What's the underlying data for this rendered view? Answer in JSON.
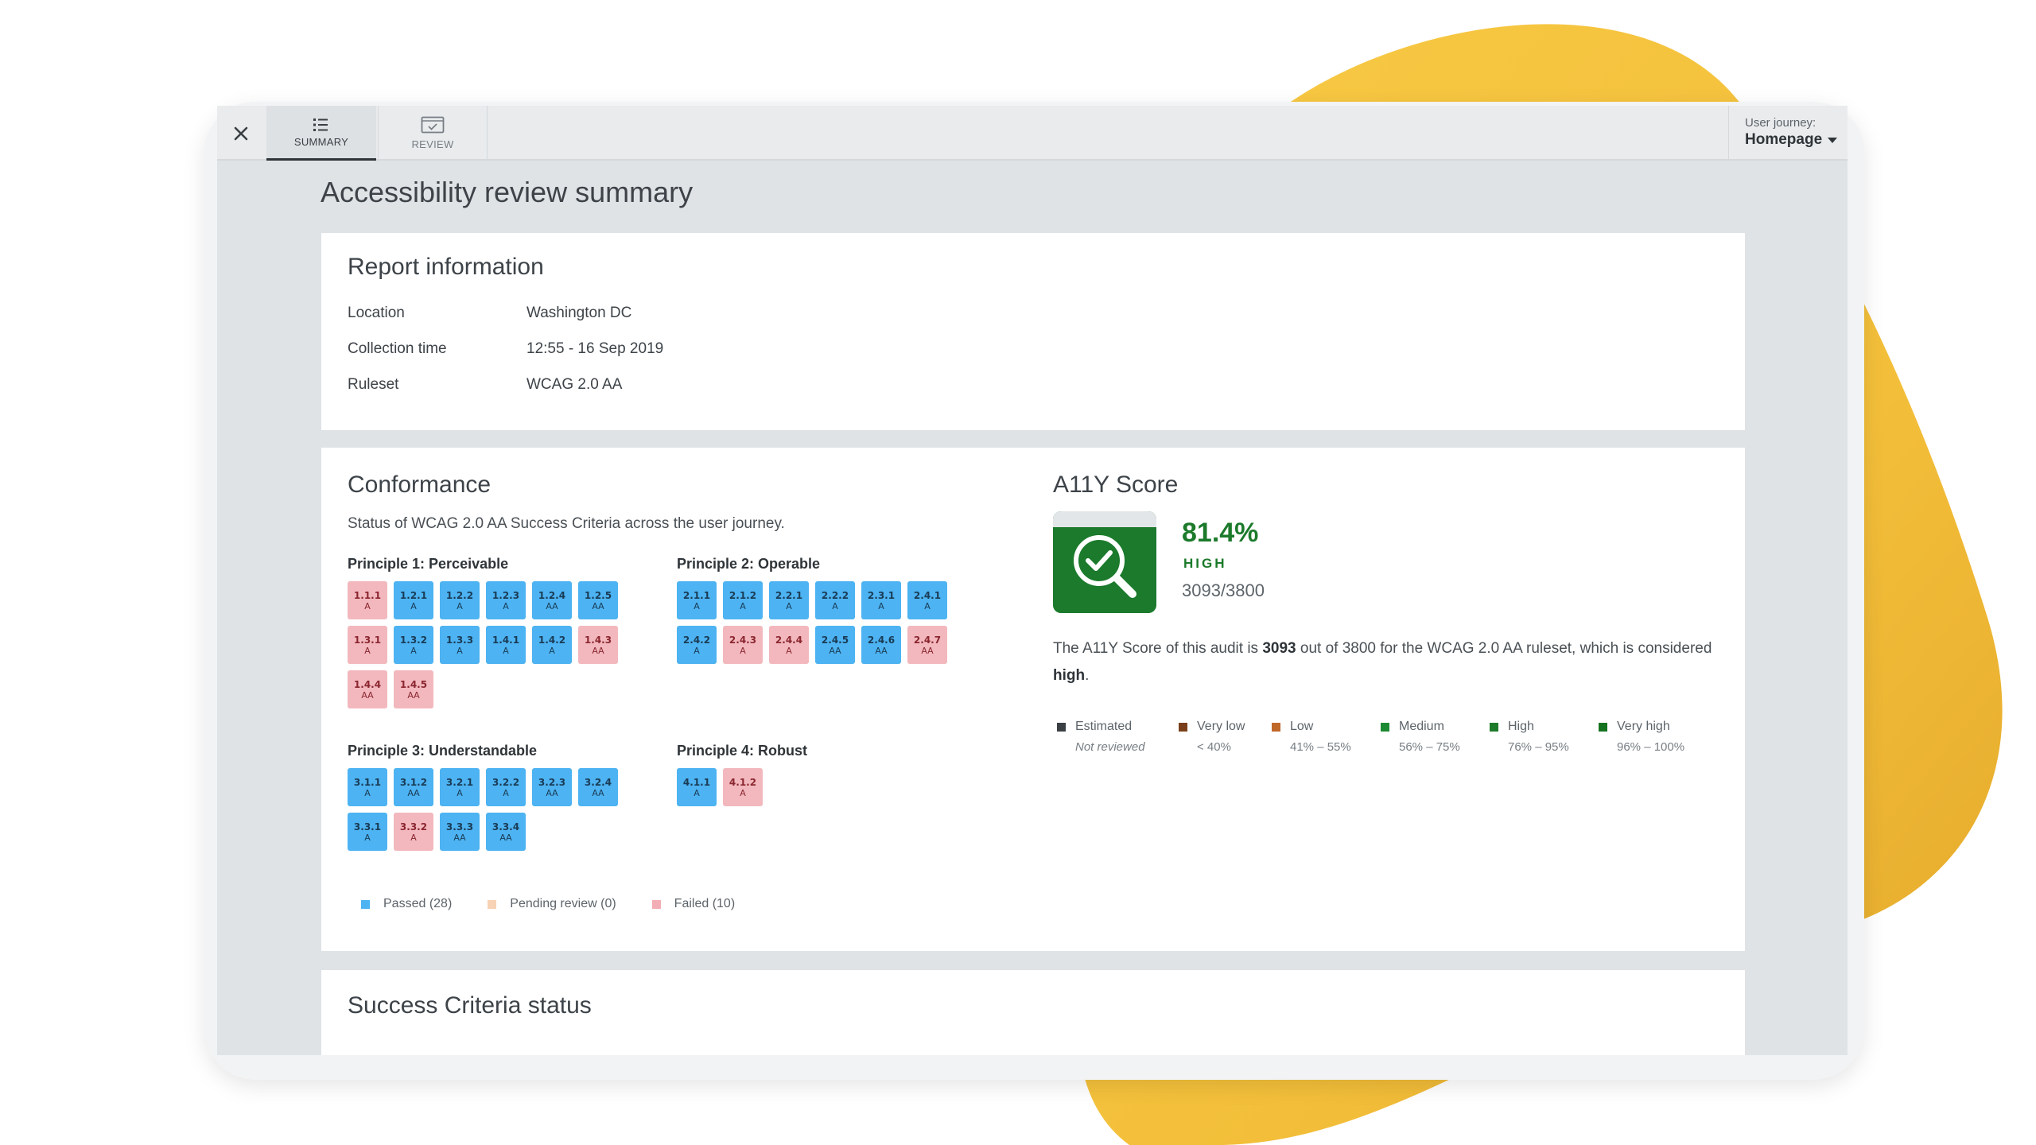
{
  "topbar": {
    "tabs": [
      {
        "label": "SUMMARY",
        "icon": "list-icon",
        "active": true
      },
      {
        "label": "REVIEW",
        "icon": "checked-screen-icon",
        "active": false
      }
    ],
    "journey_label": "User journey:",
    "journey_value": "Homepage"
  },
  "page_title": "Accessibility review summary",
  "report": {
    "title": "Report information",
    "rows": [
      {
        "label": "Location",
        "value": "Washington DC"
      },
      {
        "label": "Collection time",
        "value": "12:55 - 16 Sep 2019"
      },
      {
        "label": "Ruleset",
        "value": "WCAG 2.0 AA"
      }
    ]
  },
  "conformance": {
    "title": "Conformance",
    "subtitle": "Status of WCAG 2.0 AA Success Criteria across the user journey.",
    "principles": [
      {
        "title": "Principle 1: Perceivable",
        "criteria": [
          {
            "id": "1.1.1",
            "level": "A",
            "status": "fail"
          },
          {
            "id": "1.2.1",
            "level": "A",
            "status": "pass"
          },
          {
            "id": "1.2.2",
            "level": "A",
            "status": "pass"
          },
          {
            "id": "1.2.3",
            "level": "A",
            "status": "pass"
          },
          {
            "id": "1.2.4",
            "level": "AA",
            "status": "pass"
          },
          {
            "id": "1.2.5",
            "level": "AA",
            "status": "pass"
          },
          {
            "id": "1.3.1",
            "level": "A",
            "status": "fail"
          },
          {
            "id": "1.3.2",
            "level": "A",
            "status": "pass"
          },
          {
            "id": "1.3.3",
            "level": "A",
            "status": "pass"
          },
          {
            "id": "1.4.1",
            "level": "A",
            "status": "pass"
          },
          {
            "id": "1.4.2",
            "level": "A",
            "status": "pass"
          },
          {
            "id": "1.4.3",
            "level": "AA",
            "status": "fail"
          },
          {
            "id": "1.4.4",
            "level": "AA",
            "status": "fail"
          },
          {
            "id": "1.4.5",
            "level": "AA",
            "status": "fail"
          }
        ]
      },
      {
        "title": "Principle 2: Operable",
        "criteria": [
          {
            "id": "2.1.1",
            "level": "A",
            "status": "pass"
          },
          {
            "id": "2.1.2",
            "level": "A",
            "status": "pass"
          },
          {
            "id": "2.2.1",
            "level": "A",
            "status": "pass"
          },
          {
            "id": "2.2.2",
            "level": "A",
            "status": "pass"
          },
          {
            "id": "2.3.1",
            "level": "A",
            "status": "pass"
          },
          {
            "id": "2.4.1",
            "level": "A",
            "status": "pass"
          },
          {
            "id": "2.4.2",
            "level": "A",
            "status": "pass"
          },
          {
            "id": "2.4.3",
            "level": "A",
            "status": "fail"
          },
          {
            "id": "2.4.4",
            "level": "A",
            "status": "fail"
          },
          {
            "id": "2.4.5",
            "level": "AA",
            "status": "pass"
          },
          {
            "id": "2.4.6",
            "level": "AA",
            "status": "pass"
          },
          {
            "id": "2.4.7",
            "level": "AA",
            "status": "fail"
          }
        ]
      },
      {
        "title": "Principle 3: Understandable",
        "criteria": [
          {
            "id": "3.1.1",
            "level": "A",
            "status": "pass"
          },
          {
            "id": "3.1.2",
            "level": "AA",
            "status": "pass"
          },
          {
            "id": "3.2.1",
            "level": "A",
            "status": "pass"
          },
          {
            "id": "3.2.2",
            "level": "A",
            "status": "pass"
          },
          {
            "id": "3.2.3",
            "level": "AA",
            "status": "pass"
          },
          {
            "id": "3.2.4",
            "level": "AA",
            "status": "pass"
          },
          {
            "id": "3.3.1",
            "level": "A",
            "status": "pass"
          },
          {
            "id": "3.3.2",
            "level": "A",
            "status": "fail"
          },
          {
            "id": "3.3.3",
            "level": "AA",
            "status": "pass"
          },
          {
            "id": "3.3.4",
            "level": "AA",
            "status": "pass"
          }
        ]
      },
      {
        "title": "Principle 4: Robust",
        "criteria": [
          {
            "id": "4.1.1",
            "level": "A",
            "status": "pass"
          },
          {
            "id": "4.1.2",
            "level": "A",
            "status": "fail"
          }
        ]
      }
    ],
    "legend": [
      {
        "label": "Passed (28)",
        "color": "#4db3f2"
      },
      {
        "label": "Pending review (0)",
        "color": "#f7d2b4"
      },
      {
        "label": "Failed (10)",
        "color": "#f2aeb4"
      }
    ]
  },
  "score": {
    "title": "A11Y Score",
    "icon": "magnifier-check-icon",
    "percent": "81.4%",
    "level": "HIGH",
    "fraction": "3093/3800",
    "desc_before": "The A11Y Score of this audit is ",
    "desc_value": "3093",
    "desc_middle": " out of 3800 for the WCAG 2.0 AA ruleset, which is considered ",
    "desc_level": "high",
    "desc_end": ".",
    "scale": [
      {
        "name": "Estimated",
        "range": "Not reviewed",
        "color": "#3a3f44",
        "italic": true
      },
      {
        "name": "Very low",
        "range": "< 40%",
        "color": "#7a3f1a",
        "italic": false
      },
      {
        "name": "Low",
        "range": "41% – 55%",
        "color": "#c0672a",
        "italic": false
      },
      {
        "name": "Medium",
        "range": "56% – 75%",
        "color": "#1c8a32",
        "italic": false
      },
      {
        "name": "High",
        "range": "76% – 95%",
        "color": "#1c7a2b",
        "italic": false
      },
      {
        "name": "Very high",
        "range": "96% – 100%",
        "color": "#15731f",
        "italic": false
      }
    ]
  },
  "success_criteria": {
    "title": "Success Criteria status"
  }
}
